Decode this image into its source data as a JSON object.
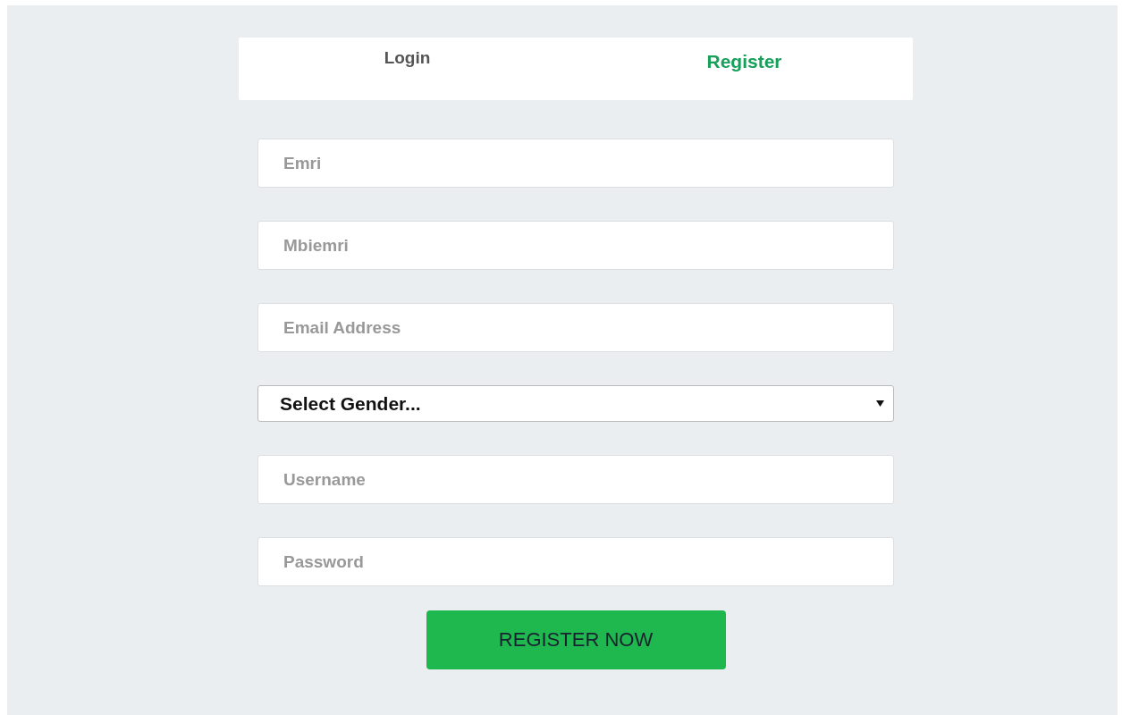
{
  "tabs": [
    {
      "label": "Login",
      "selected": false
    },
    {
      "label": "Register",
      "selected": true
    }
  ],
  "fields": [
    {
      "kind": "text",
      "placeholder": "Emri"
    },
    {
      "kind": "text",
      "placeholder": "Mbiemri"
    },
    {
      "kind": "text",
      "placeholder": "Email Address"
    },
    {
      "kind": "select",
      "value": "Select Gender..."
    },
    {
      "kind": "text",
      "placeholder": "Username"
    },
    {
      "kind": "password",
      "placeholder": "Password"
    }
  ],
  "submit": "REGISTER NOW"
}
